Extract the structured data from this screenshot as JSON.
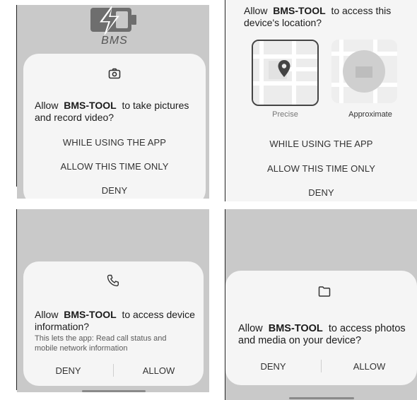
{
  "app_name": "BMS-TOOL",
  "logo_text": "BMS",
  "camera_dialog": {
    "icon": "camera-icon",
    "title_pre": "Allow",
    "title_app": "BMS-TOOL",
    "title_post": "to take pictures and record video?",
    "options": [
      "WHILE USING THE APP",
      "ALLOW THIS TIME ONLY",
      "DENY"
    ]
  },
  "location_dialog": {
    "title_pre": "Allow",
    "title_app": "BMS-TOOL",
    "title_post": "to access this device's location?",
    "precise_label": "Precise",
    "approximate_label": "Approximate",
    "options": [
      "WHILE USING THE APP",
      "ALLOW THIS TIME ONLY",
      "DENY"
    ]
  },
  "phone_dialog": {
    "icon": "phone-icon",
    "title_pre": "Allow",
    "title_app": "BMS-TOOL",
    "title_post": "to access device information?",
    "subtitle": "This lets the app: Read call status and mobile network information",
    "deny": "DENY",
    "allow": "ALLOW"
  },
  "media_dialog": {
    "icon": "folder-icon",
    "title_pre": "Allow",
    "title_app": "BMS-TOOL",
    "title_post": "to access photos and media on your device?",
    "deny": "DENY",
    "allow": "ALLOW"
  },
  "colors": {
    "panel_bg": "#c9c9c9",
    "dialog_bg": "#f5f5f5",
    "text": "#1b1b1b",
    "button_text": "#333333"
  }
}
